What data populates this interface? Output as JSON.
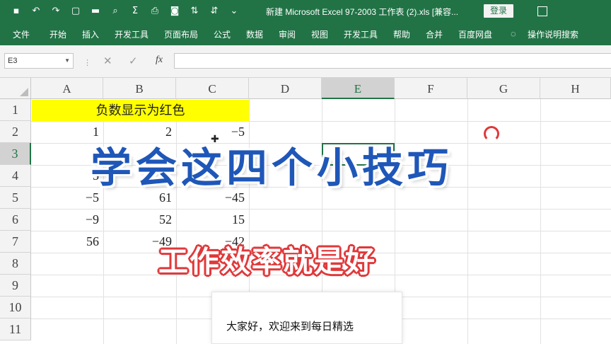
{
  "titlebar": {
    "doc_title": "新建 Microsoft Excel 97-2003 工作表 (2).xls  [兼容...",
    "login": "登录",
    "bg_color": "#217346"
  },
  "qat_icons": [
    "save-icon",
    "undo-icon",
    "redo-icon",
    "new-file-icon",
    "open-folder-icon",
    "print-preview-icon",
    "sum-icon",
    "print-icon",
    "camera-icon",
    "sort-icon",
    "filter-icon",
    "more-icon"
  ],
  "ribbon": {
    "tabs": [
      "文件",
      "开始",
      "插入",
      "开发工具",
      "页面布局",
      "公式",
      "数据",
      "审阅",
      "视图",
      "开发工具",
      "帮助",
      "合并",
      "百度网盘",
      "操作说明搜索"
    ]
  },
  "formula_bar": {
    "name_box": "E3",
    "fx": "fx",
    "value": ""
  },
  "sheet": {
    "columns": [
      "A",
      "B",
      "C",
      "D",
      "E",
      "F",
      "G",
      "H"
    ],
    "rows": [
      "1",
      "2",
      "3",
      "4",
      "5",
      "6",
      "7",
      "8",
      "9",
      "10",
      "11"
    ],
    "merged_header": "负数显示为红色",
    "cells": [
      {
        "row": 2,
        "a": "1",
        "b": "2",
        "c": "−5"
      },
      {
        "row": 3,
        "a": "",
        "b": "",
        "c": ""
      },
      {
        "row": 4,
        "a": "5",
        "b": "",
        "c": ""
      },
      {
        "row": 5,
        "a": "−5",
        "b": "61",
        "c": "−45"
      },
      {
        "row": 6,
        "a": "−9",
        "b": "52",
        "c": "15"
      },
      {
        "row": 7,
        "a": "56",
        "b": "−49",
        "c": "−42"
      }
    ],
    "selected_cell": "E3",
    "highlight_color": "#ffff00"
  },
  "overlay": {
    "title": "学会这四个小技巧",
    "subtitle": "工作效率就是好",
    "caption": "大家好，欢迎来到每日精选",
    "title_color": "#1f57b8",
    "subtitle_outline": "#e0383a"
  }
}
